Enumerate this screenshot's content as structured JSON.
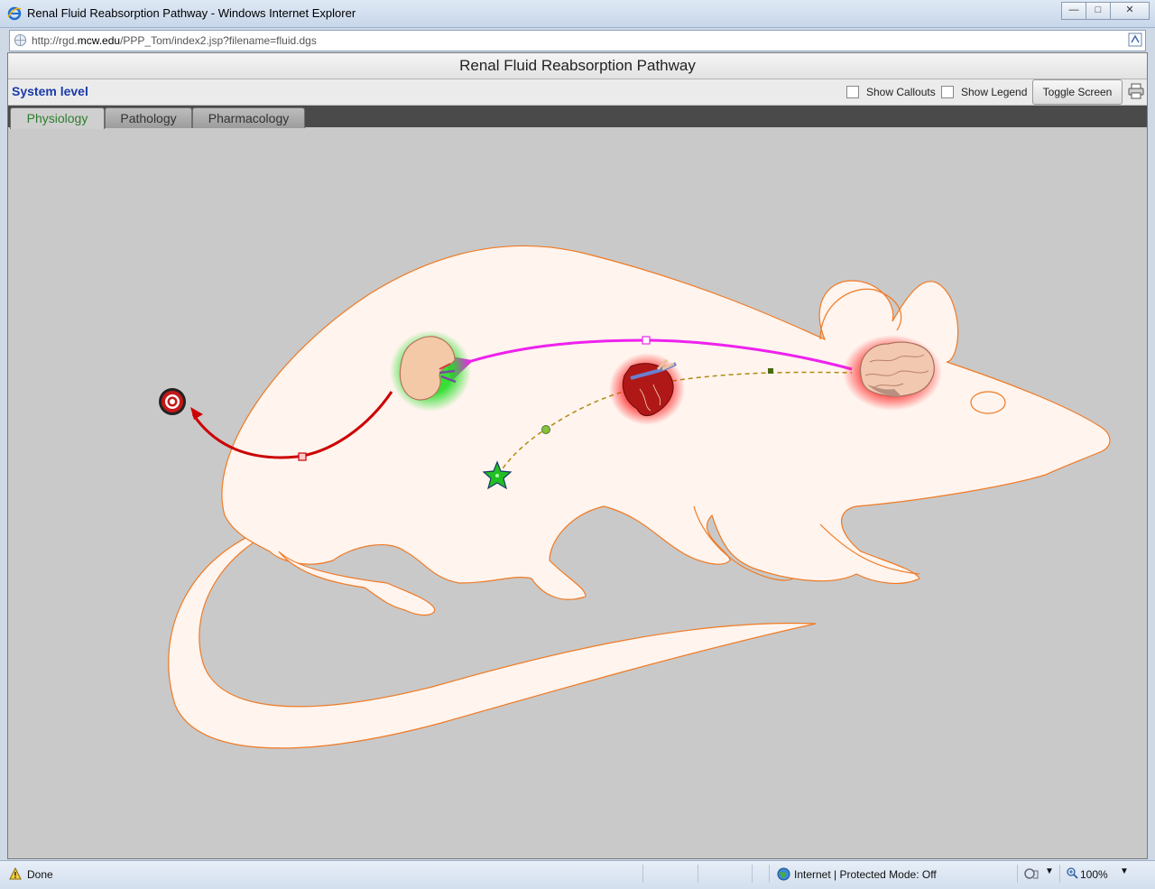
{
  "window": {
    "title": "Renal Fluid Reabsorption Pathway - Windows Internet Explorer",
    "url_prefix": "http://rgd.",
    "url_domain": "mcw.edu",
    "url_suffix": "/PPP_Tom/index2.jsp?filename=fluid.dgs"
  },
  "app": {
    "title": "Renal Fluid Reabsorption Pathway",
    "level_label": "System level",
    "show_callouts_label": "Show Callouts",
    "show_legend_label": "Show Legend",
    "toggle_screen_label": "Toggle Screen",
    "tabs": [
      {
        "label": "Physiology",
        "active": true
      },
      {
        "label": "Pathology",
        "active": false
      },
      {
        "label": "Pharmacology",
        "active": false
      }
    ]
  },
  "status": {
    "text": "Done",
    "zone": "Internet | Protected Mode: Off",
    "zoom": "100%"
  },
  "colors": {
    "rat_fill": "#fff4ee",
    "rat_stroke": "#f07a24",
    "brain_to_kidney_arrow": "#ee22ee",
    "kidney_output_arrow": "#cc0000",
    "dashed_path": "#b08a10",
    "kidney_glow": "#22dd22",
    "organ_glow": "#ff2020"
  }
}
